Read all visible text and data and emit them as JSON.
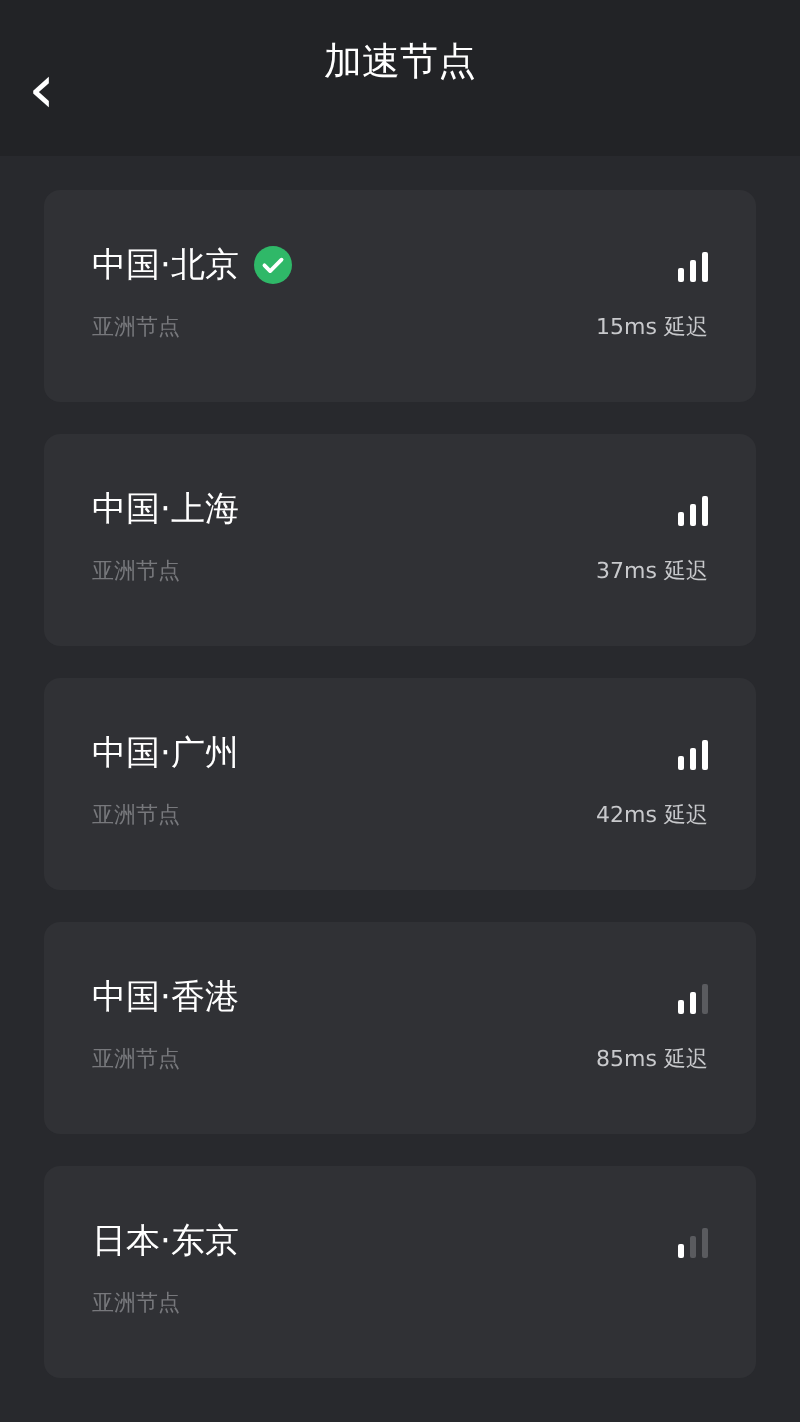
{
  "header": {
    "back_icon": "‹",
    "title": "加速节点"
  },
  "nodes": [
    {
      "name": "中国·北京",
      "selected": true,
      "region": "亚洲节点",
      "kind": "strong",
      "latency": "15ms 延迟"
    },
    {
      "name": "中国·上海",
      "selected": false,
      "region": "亚洲节点",
      "kind": "strong",
      "latency": "37ms 延迟"
    },
    {
      "name": "中国·广州",
      "selected": false,
      "region": "亚洲节点",
      "kind": "strong",
      "latency": "42ms 延迟"
    },
    {
      "name": "中国·香港",
      "selected": false,
      "region": "亚洲节点",
      "kind": "medium",
      "latency": "85ms 延迟"
    },
    {
      "name": "日本·东京",
      "selected": false,
      "region": "亚洲节点",
      "kind": "weak"
    }
  ]
}
